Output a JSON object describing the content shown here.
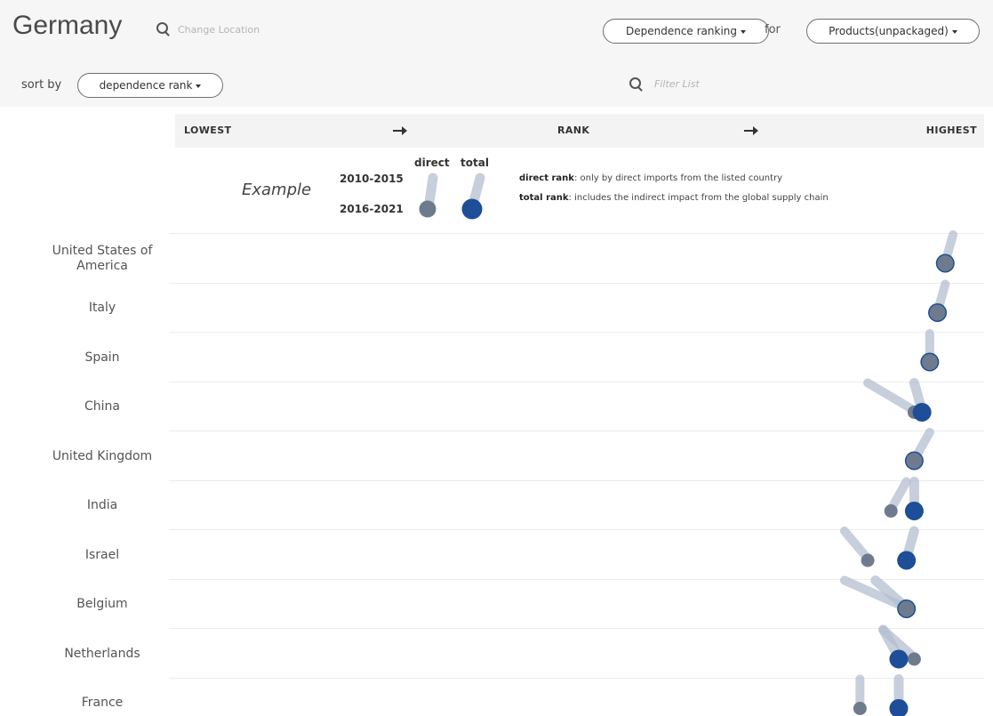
{
  "header": {
    "location": "Germany",
    "search_placeholder": "Change Location",
    "ranking_label": "Dependence ranking",
    "for_label": "for",
    "product_label": "Products(unpackaged)"
  },
  "sort": {
    "label": "sort by",
    "value": "dependence rank",
    "filter_placeholder": "Filter List"
  },
  "legend": {
    "example_label": "Example",
    "col_direct": "direct",
    "col_total": "total",
    "period_old": "2010-2015",
    "period_new": "2016-2021",
    "direct_term": "direct rank",
    "direct_desc": ": only by direct imports from the listed country",
    "total_term": "total rank",
    "total_desc": ": includes the indirect impact from the global supply chain"
  },
  "colors": {
    "direct": "#6e7b8e",
    "total": "#1d4e97",
    "trail": "#b3bfcf"
  },
  "chart_data": {
    "type": "scatter",
    "axis": {
      "left": "LOWEST",
      "center": "RANK",
      "right": "HIGHEST"
    },
    "rank_scale": "0 = lowest, 100 = highest (relative position)",
    "series": [
      {
        "name": "direct",
        "period": "2016-2021"
      },
      {
        "name": "total",
        "period": "2016-2021"
      }
    ],
    "rows": [
      {
        "country": "United States of America",
        "direct_prev": 100,
        "direct": 99,
        "total_prev": 100,
        "total": 99
      },
      {
        "country": "Italy",
        "direct_prev": 99,
        "direct": 98,
        "total_prev": 99,
        "total": 98
      },
      {
        "country": "Spain",
        "direct_prev": 97,
        "direct": 97,
        "total_prev": 97,
        "total": 97
      },
      {
        "country": "China",
        "direct_prev": 89,
        "direct": 95,
        "total_prev": 95,
        "total": 96
      },
      {
        "country": "United Kingdom",
        "direct_prev": 97,
        "direct": 95,
        "total_prev": 97,
        "total": 95
      },
      {
        "country": "India",
        "direct_prev": 94,
        "direct": 92,
        "total_prev": 95,
        "total": 95
      },
      {
        "country": "Israel",
        "direct_prev": 86,
        "direct": 89,
        "total_prev": 95,
        "total": 94
      },
      {
        "country": "Belgium",
        "direct_prev": 86,
        "direct": 94,
        "total_prev": 90,
        "total": 94
      },
      {
        "country": "Netherlands",
        "direct_prev": 91,
        "direct": 95,
        "total_prev": 91,
        "total": 93
      },
      {
        "country": "France",
        "direct_prev": 88,
        "direct": 88,
        "total_prev": 93,
        "total": 93
      }
    ]
  }
}
